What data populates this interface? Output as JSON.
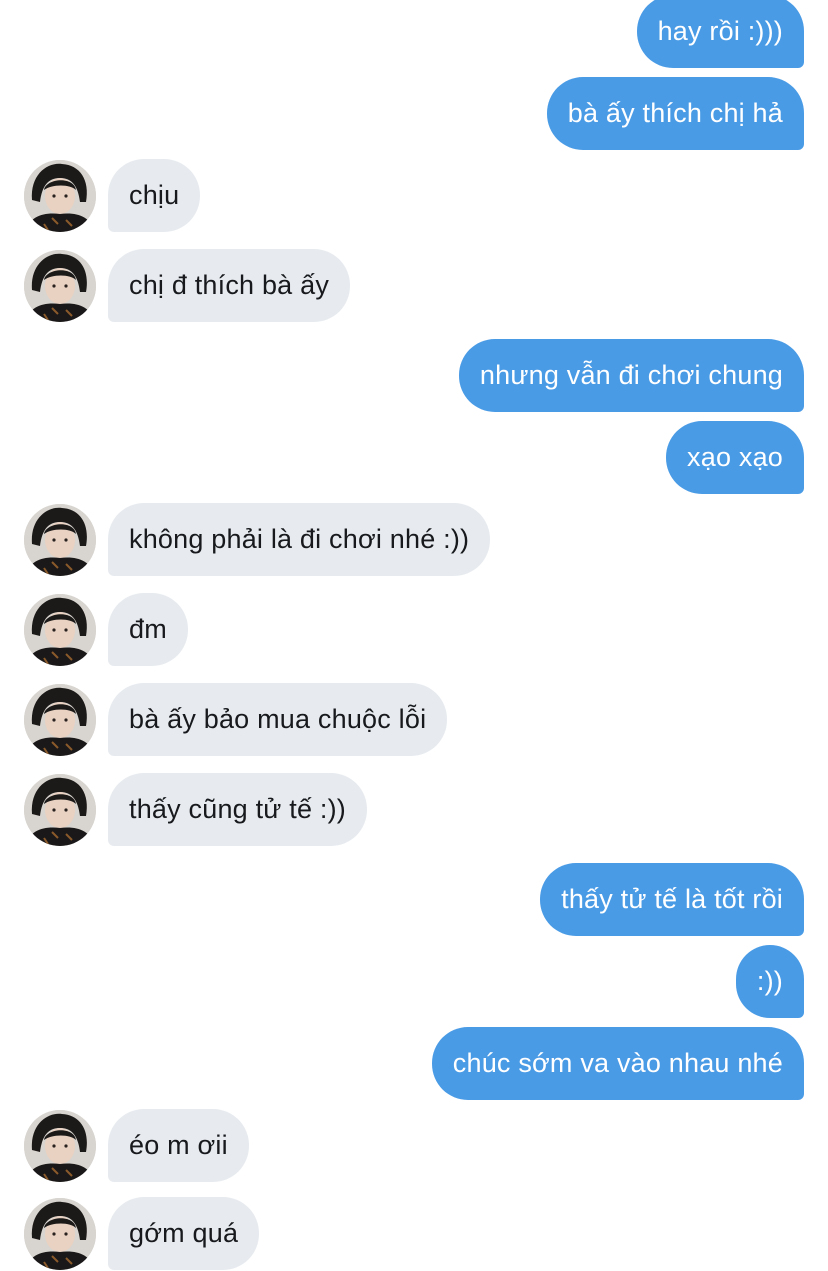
{
  "conversation": {
    "messages": [
      {
        "from": "me",
        "text": "hay rồi :)))"
      },
      {
        "from": "me",
        "text": "bà ấy thích chị hả"
      },
      {
        "from": "them",
        "text": "chịu"
      },
      {
        "from": "them",
        "text": "chị đ thích bà ấy"
      },
      {
        "from": "me",
        "text": "nhưng vẫn đi chơi chung"
      },
      {
        "from": "me",
        "text": "xạo xạo"
      },
      {
        "from": "them",
        "text": "không phải là đi chơi nhé :))"
      },
      {
        "from": "them",
        "text": "đm"
      },
      {
        "from": "them",
        "text": "bà ấy bảo mua chuộc lỗi"
      },
      {
        "from": "them",
        "text": "thấy cũng tử tế :))"
      },
      {
        "from": "me",
        "text": "thấy tử tế là tốt rồi"
      },
      {
        "from": "me",
        "text": ":))"
      },
      {
        "from": "me",
        "text": "chúc sớm va vào nhau nhé"
      },
      {
        "from": "them",
        "text": "éo m ơii"
      },
      {
        "from": "them",
        "text": "gớm quá"
      }
    ]
  },
  "colors": {
    "outgoing_bubble": "#4a9be6",
    "incoming_bubble": "#e7ebef",
    "incoming_text": "#17191c",
    "background": "#ffffff"
  },
  "icons": {
    "contact_avatar": "avatar-icon"
  }
}
